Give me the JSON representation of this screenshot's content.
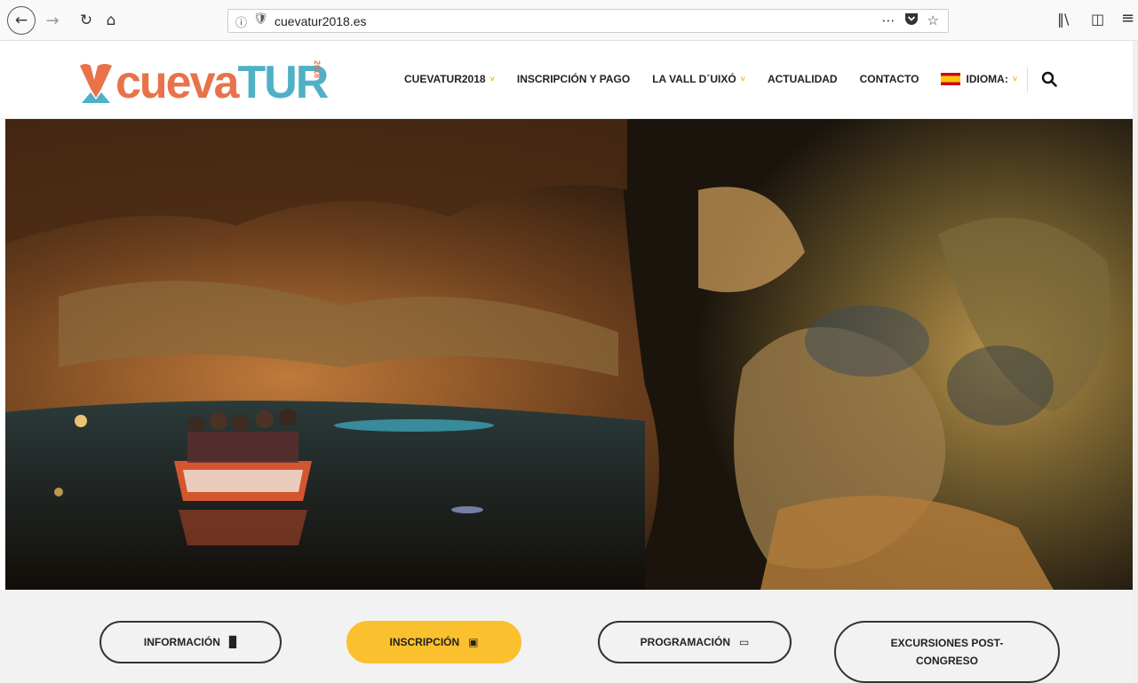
{
  "browser": {
    "url": "cuevatur2018.es",
    "page_actions": "⋯",
    "back_icon": "←",
    "forward_icon": "→",
    "reload_icon": "↻",
    "home_icon": "⌂",
    "library_icon": "‖\\",
    "sidebar_icon": "◫",
    "menu_icon": "≡"
  },
  "logo": {
    "text_main": "cueva",
    "text_accent": "TUR",
    "year": "2018"
  },
  "nav": {
    "items": [
      {
        "label": "CUEVATUR2018",
        "has_dropdown": true
      },
      {
        "label": "INSCRIPCIÓN Y PAGO",
        "has_dropdown": false
      },
      {
        "label": "LA VALL D´UIXÓ",
        "has_dropdown": true
      },
      {
        "label": "ACTUALIDAD",
        "has_dropdown": false
      },
      {
        "label": "CONTACTO",
        "has_dropdown": false
      }
    ],
    "language_label": "IDIOMA:",
    "chevron": "˅"
  },
  "buttons": {
    "info": "INFORMACIÓN",
    "inscripcion": "INSCRIPCIÓN",
    "programacion": "PROGRAMACIÓN",
    "excursiones_line1": "EXCURSIONES POST-",
    "excursiones_line2": "CONGRESO"
  },
  "colors": {
    "brand_orange": "#e8734a",
    "brand_teal": "#4fb0c6",
    "accent_yellow": "#fbc02d"
  }
}
